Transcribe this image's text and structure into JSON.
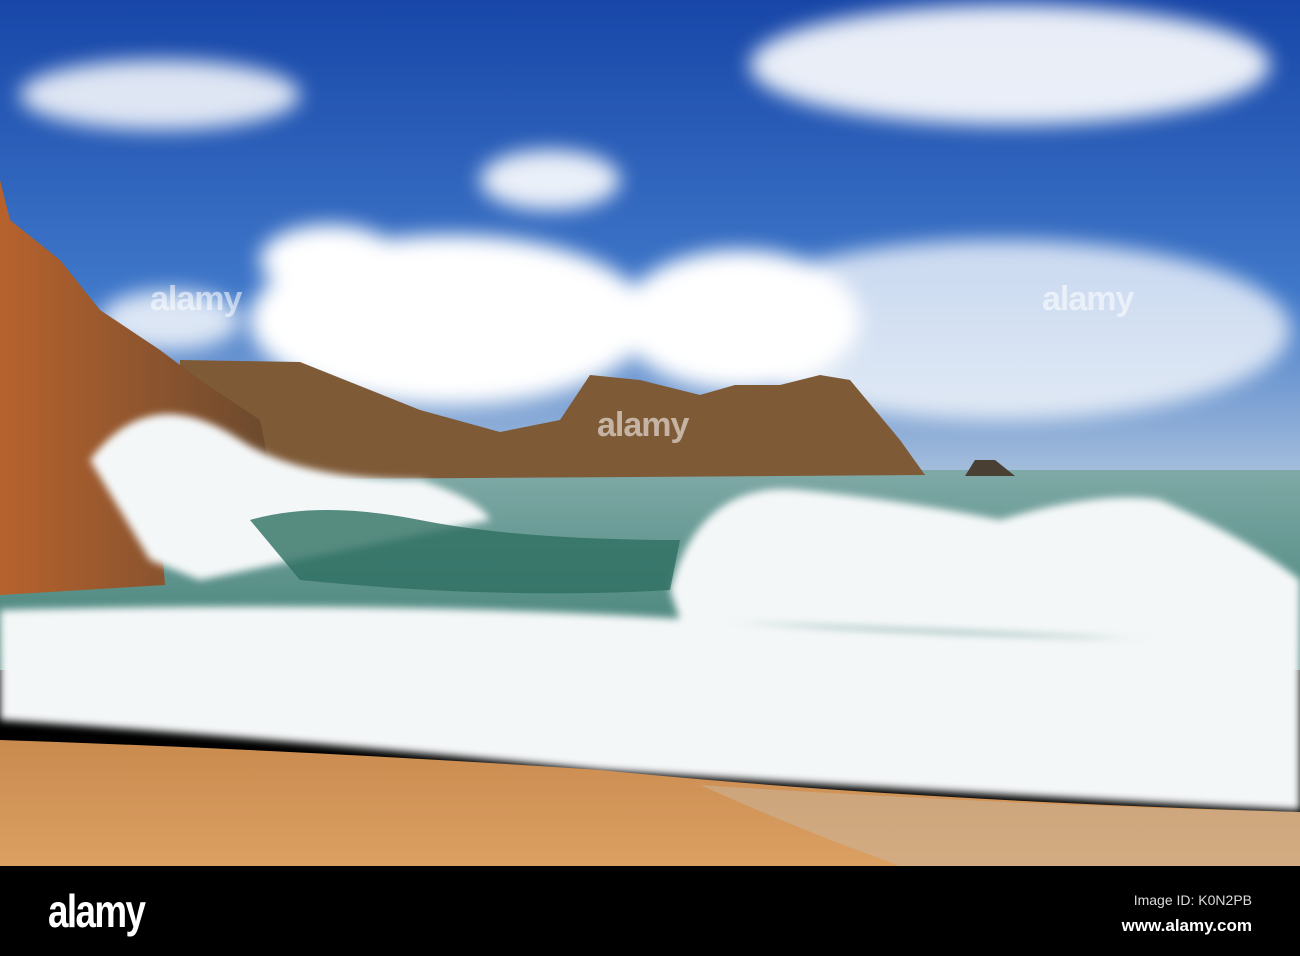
{
  "photo": {
    "subject": "waves on beach",
    "colors": {
      "sky_top": "#1b4fae",
      "sky_low": "#5f8fd0",
      "rock": "#a2572a",
      "sea": "#5e9a8e",
      "foam": "#f3f6f8",
      "sand": "#d5934f"
    },
    "watermark": "alamy"
  },
  "footer": {
    "logo": "alamy",
    "image_id": "Image ID: K0N2PB",
    "website": "www.alamy.com"
  }
}
